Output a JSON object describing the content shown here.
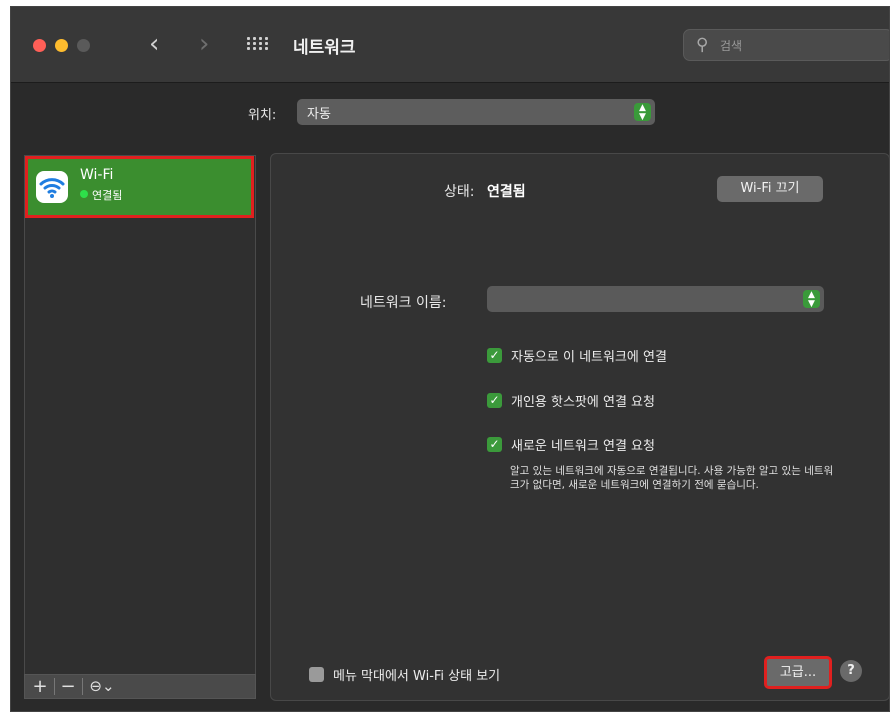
{
  "window": {
    "title": "네트워크",
    "nav": {
      "back": "‹",
      "forward": "›"
    },
    "search": {
      "placeholder": "검색",
      "icon": "magnifier-icon"
    }
  },
  "location": {
    "label": "위치:",
    "value": "자동"
  },
  "sidebar": {
    "services": [
      {
        "name": "Wi-Fi",
        "status": "연결됨",
        "status_color": "#2ee04a",
        "icon": "wifi-icon"
      }
    ],
    "footer": {
      "add": "+",
      "remove": "−",
      "action": "⊖⌄"
    }
  },
  "detail": {
    "status_label": "상태:",
    "status_value": "연결됨",
    "wifi_off_button": "Wi-Fi 끄기",
    "network_name_label": "네트워크 이름:",
    "network_name_value": "",
    "options": [
      {
        "label": "자동으로 이 네트워크에 연결",
        "checked": true
      },
      {
        "label": "개인용 핫스팟에 연결 요청",
        "checked": true
      },
      {
        "label": "새로운 네트워크 연결 요청",
        "checked": true
      }
    ],
    "hint": "알고 있는 네트워크에 자동으로 연결됩니다. 사용 가능한 알고 있는 네트워크가 없다면, 새로운 네트워크에 연결하기 전에 묻습니다.",
    "menubar_option": {
      "label": "메뉴 막대에서 Wi-Fi 상태 보기",
      "checked": false
    },
    "advanced_button": "고급...",
    "help_button": "?"
  },
  "colors": {
    "accent_green": "#3b8e2f",
    "highlight_red": "#e0201f",
    "background": "#2a2a2a"
  }
}
